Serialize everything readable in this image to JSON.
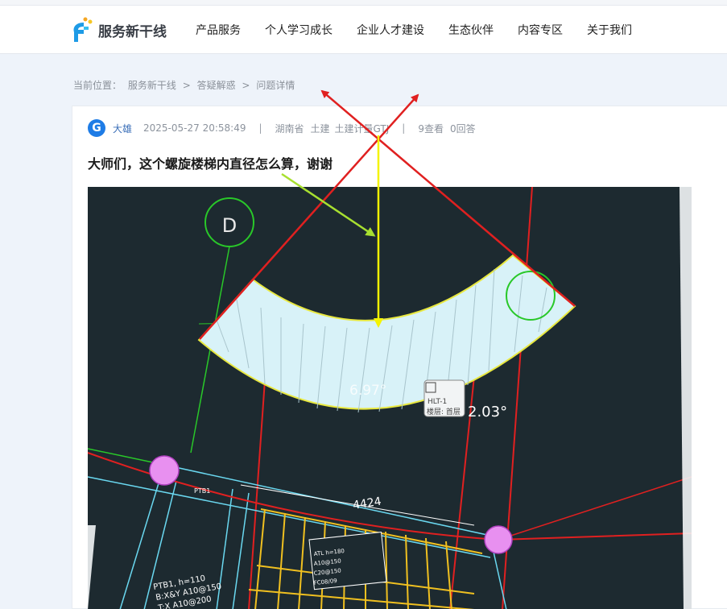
{
  "header": {
    "logo_text": "服务新干线",
    "nav": [
      "产品服务",
      "个人学习成长",
      "企业人才建设",
      "生态伙伴",
      "内容专区",
      "关于我们"
    ]
  },
  "breadcrumb": {
    "label": "当前位置：",
    "items": [
      "服务新干线",
      "答疑解惑",
      "问题详情"
    ],
    "separator": ">"
  },
  "question": {
    "avatar_letter": "G",
    "author": "大雄",
    "datetime": "2025-05-27 20:58:49",
    "region": "湖南省",
    "tags": [
      "土建",
      "土建计量GTJ"
    ],
    "views": "9查看",
    "answers": "0回答",
    "title": "大师们，这个螺旋楼梯内直径怎么算，谢谢"
  },
  "drawing": {
    "grid_label": "D",
    "angle_1": "6.97°",
    "angle_2": "2.03°",
    "component_name": "HLT-1",
    "component_floor": "楼层: 首层",
    "dimension": "4424",
    "beam_label": "PTB1",
    "beam_h": "PTB1, h=110",
    "beam_rebar": "B:X&Y A10@150",
    "beam_rebar_2": "T:X A10@200",
    "note_1": "ATL h=180",
    "note_2": "A10@150",
    "note_3": "C20@150",
    "note_4": "FC08/09"
  },
  "colors": {
    "accent": "#1e7ce6",
    "red_annotation": "#e02020",
    "yellow_annotation": "#f4f400",
    "green_annotation": "#a8e030"
  }
}
